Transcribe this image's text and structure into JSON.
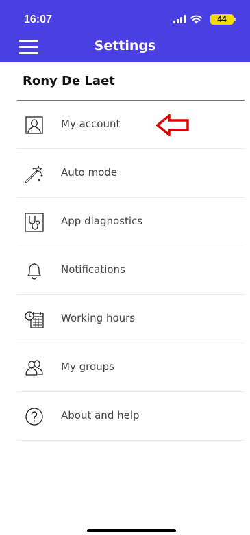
{
  "status_bar": {
    "time": "16:07",
    "battery": "44"
  },
  "app_bar": {
    "title": "Settings",
    "menu_icon": "hamburger-menu-icon"
  },
  "user": {
    "name": "Rony De Laet"
  },
  "menu": {
    "items": [
      {
        "label": "My account",
        "icon": "user-profile-icon"
      },
      {
        "label": "Auto mode",
        "icon": "magic-wand-icon"
      },
      {
        "label": "App diagnostics",
        "icon": "stethoscope-icon"
      },
      {
        "label": "Notifications",
        "icon": "bell-icon"
      },
      {
        "label": "Working hours",
        "icon": "calendar-clock-icon"
      },
      {
        "label": "My groups",
        "icon": "users-group-icon"
      },
      {
        "label": "About and help",
        "icon": "question-circle-icon"
      }
    ]
  },
  "annotation": {
    "arrow_color": "#e00000"
  },
  "colors": {
    "accent": "#4a3fe0",
    "text": "#444444"
  }
}
